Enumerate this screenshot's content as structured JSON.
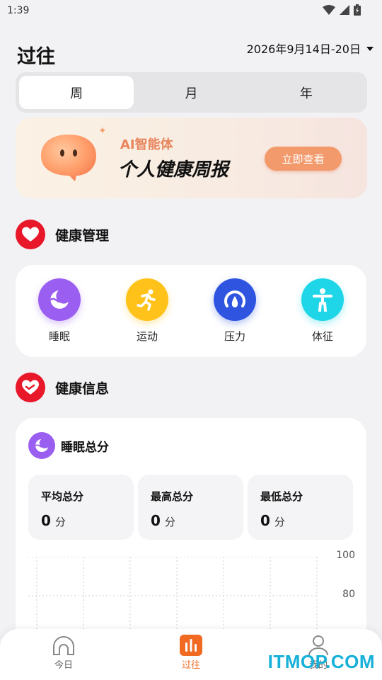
{
  "status_bar": {
    "time": "1:39"
  },
  "header": {
    "title": "过往",
    "date_range": "2026年9月14日-20日"
  },
  "tabs": [
    {
      "label": "周",
      "active": true
    },
    {
      "label": "月",
      "active": false
    },
    {
      "label": "年",
      "active": false
    }
  ],
  "banner": {
    "subtitle": "AI智能体",
    "title": "个人健康周报",
    "button_label": "立即查看"
  },
  "health_management": {
    "title": "健康管理",
    "items": [
      {
        "label": "睡眠",
        "icon": "sleep-icon",
        "color": "#9a5ef0"
      },
      {
        "label": "运动",
        "icon": "running-icon",
        "color": "#ffc21a"
      },
      {
        "label": "压力",
        "icon": "pressure-gauge-icon",
        "color": "#2f55e0"
      },
      {
        "label": "体征",
        "icon": "body-icon",
        "color": "#1fd6e8"
      }
    ]
  },
  "health_info": {
    "title": "健康信息",
    "sleep_card": {
      "title": "睡眠总分",
      "stats": [
        {
          "label": "平均总分",
          "value": "0",
          "unit": "分"
        },
        {
          "label": "最高总分",
          "value": "0",
          "unit": "分"
        },
        {
          "label": "最低总分",
          "value": "0",
          "unit": "分"
        }
      ]
    }
  },
  "chart_data": {
    "type": "bar",
    "y_ticks": [
      "100",
      "80"
    ]
  },
  "bottom_nav": [
    {
      "label": "今日",
      "icon": "today-icon",
      "active": false
    },
    {
      "label": "过往",
      "icon": "history-chart-icon",
      "active": true
    },
    {
      "label": "我的",
      "icon": "profile-icon",
      "active": false
    }
  ],
  "watermark": "ITMOP.COM",
  "colors": {
    "accent": "#f06a22",
    "heart_red": "#e8172a",
    "banner_button": "#f29a6c"
  }
}
